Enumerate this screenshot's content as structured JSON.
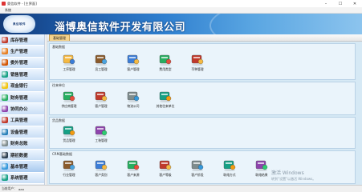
{
  "window": {
    "title": "奥信软件 - [主界面]"
  },
  "menu": {
    "item": "系统"
  },
  "banner": {
    "company_name": "淄博奥信软件开发有限公司",
    "logo_text": "奥信软件"
  },
  "sidebar": {
    "items": [
      {
        "label": "库存管理",
        "color": "#c0392b"
      },
      {
        "label": "生产管理",
        "color": "#e67e22"
      },
      {
        "label": "委外管理",
        "color": "#d35400"
      },
      {
        "label": "销售管理",
        "color": "#16a085"
      },
      {
        "label": "现金银行",
        "color": "#f1c40f"
      },
      {
        "label": "财务管理",
        "color": "#27ae60"
      },
      {
        "label": "协同办公",
        "color": "#8e44ad"
      },
      {
        "label": "工具管理",
        "color": "#c0392b"
      },
      {
        "label": "设备管理",
        "color": "#2980b9"
      },
      {
        "label": "财务总账",
        "color": "#7f8c8d"
      },
      {
        "label": "期初数据",
        "color": "#2c3e50"
      },
      {
        "label": "基本管理",
        "color": "#3498db"
      },
      {
        "label": "系统管理",
        "color": "#16a085"
      }
    ]
  },
  "tabs": {
    "active": "基础管理"
  },
  "sections": [
    {
      "title": "基础数据",
      "items": [
        "工序管理",
        "员工管理",
        "客户管理",
        "费用类型",
        "币种管理"
      ]
    },
    {
      "title": "往来单位",
      "items": [
        "供应商管理",
        "客户管理",
        "物流公司",
        "其他往来单位"
      ]
    },
    {
      "title": "货品数据",
      "items": [
        "货品管理",
        "工装管理"
      ]
    },
    {
      "title": "CRM基础数据",
      "items": [
        "行业管理",
        "客户类别",
        "客户来源",
        "客户等级",
        "客户阶段",
        "联络方式",
        "联络结果"
      ]
    }
  ],
  "statusbar": {
    "user_label": "当前用户：",
    "user": "aaa"
  },
  "watermark": {
    "line1": "激活 Windows",
    "line2": "转到“设置”以激活 Windows。"
  }
}
